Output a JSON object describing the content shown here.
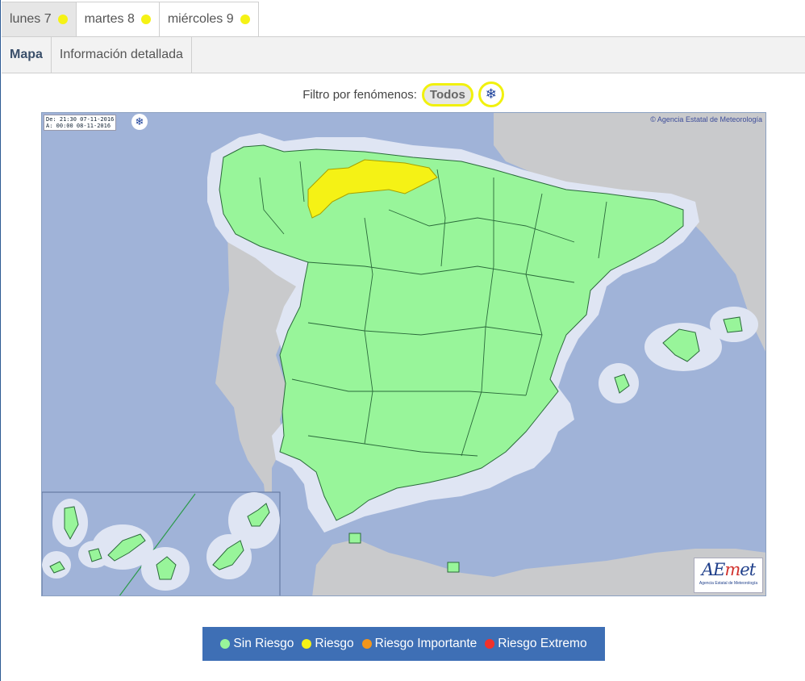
{
  "days": [
    {
      "label": "lunes 7",
      "color": "#f5f215",
      "active": true
    },
    {
      "label": "martes 8",
      "color": "#f5f215",
      "active": false
    },
    {
      "label": "miércoles 9",
      "color": "#f5f215",
      "active": false
    }
  ],
  "subtabs": [
    {
      "label": "Mapa",
      "active": true
    },
    {
      "label": "Información detallada",
      "active": false
    }
  ],
  "filter": {
    "label": "Filtro por fenómenos:",
    "todos": "Todos",
    "snow_icon": "snowflake-icon"
  },
  "map": {
    "validity_from": "De: 21:30 07-11-2016",
    "validity_to": "A:  00:00 08-11-2016",
    "copyright": "© Agencia Estatal de Meteorología",
    "logo_main": "AEmet",
    "logo_sub": "Agencia Estatal de Meteorología",
    "colors": {
      "sea": "#a0b3d8",
      "land_other": "#c9cacc",
      "coast_buffer": "#dfe5f3",
      "sin_riesgo": "#98f59a",
      "riesgo": "#f5f215",
      "border": "#2a6a3a"
    }
  },
  "legend": [
    {
      "label": "Sin Riesgo",
      "color": "#98f59a"
    },
    {
      "label": "Riesgo",
      "color": "#f5f215"
    },
    {
      "label": "Riesgo Importante",
      "color": "#f2961c"
    },
    {
      "label": "Riesgo Extremo",
      "color": "#f2312a"
    }
  ]
}
